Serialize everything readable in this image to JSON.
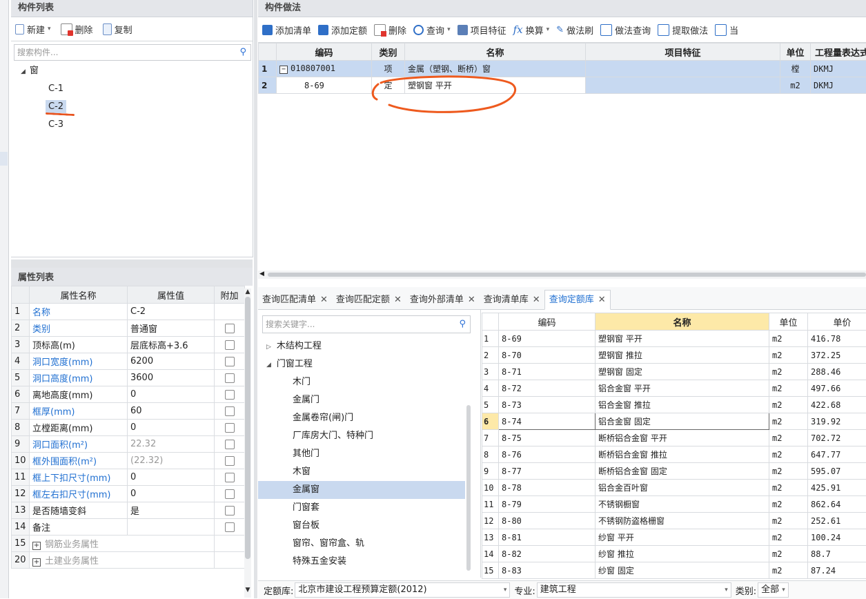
{
  "left_top": {
    "header": "构件列表",
    "toolbar": {
      "new": "新建",
      "delete": "删除",
      "copy": "复制"
    },
    "search_placeholder": "搜索构件...",
    "tree": {
      "root": "窗",
      "items": [
        "C-1",
        "C-2",
        "C-3"
      ]
    }
  },
  "props": {
    "header": "属性列表",
    "cols": [
      "属性名称",
      "属性值",
      "附加"
    ],
    "rows": [
      {
        "n": "1",
        "name": "名称",
        "value": "C-2",
        "blue": true,
        "cb": false
      },
      {
        "n": "2",
        "name": "类别",
        "value": "普通窗",
        "blue": true,
        "cb": true
      },
      {
        "n": "3",
        "name": "顶标高(m)",
        "value": "层底标高+3.6",
        "blue": false,
        "cb": true
      },
      {
        "n": "4",
        "name": "洞口宽度(mm)",
        "value": "6200",
        "blue": true,
        "cb": true
      },
      {
        "n": "5",
        "name": "洞口高度(mm)",
        "value": "3600",
        "blue": true,
        "cb": true
      },
      {
        "n": "6",
        "name": "离地高度(mm)",
        "value": "0",
        "blue": false,
        "cb": true
      },
      {
        "n": "7",
        "name": "框厚(mm)",
        "value": "60",
        "blue": true,
        "cb": true
      },
      {
        "n": "8",
        "name": "立樘距离(mm)",
        "value": "0",
        "blue": false,
        "cb": true
      },
      {
        "n": "9",
        "name": "洞口面积(m²)",
        "value": "22.32",
        "blue": true,
        "cb": true,
        "gray": true
      },
      {
        "n": "10",
        "name": "框外围面积(m²)",
        "value": "(22.32)",
        "blue": true,
        "cb": true,
        "gray": true
      },
      {
        "n": "11",
        "name": "框上下扣尺寸(mm)",
        "value": "0",
        "blue": true,
        "cb": true
      },
      {
        "n": "12",
        "name": "框左右扣尺寸(mm)",
        "value": "0",
        "blue": true,
        "cb": true
      },
      {
        "n": "13",
        "name": "是否随墙变斜",
        "value": "是",
        "blue": false,
        "cb": true
      },
      {
        "n": "14",
        "name": "备注",
        "value": "",
        "blue": false,
        "cb": true
      },
      {
        "n": "15",
        "name": "钢筋业务属性",
        "value": "",
        "blue": false,
        "cb": false,
        "group": true
      },
      {
        "n": "20",
        "name": "土建业务属性",
        "value": "",
        "blue": false,
        "cb": false,
        "group": true
      }
    ]
  },
  "method": {
    "header": "构件做法",
    "toolbar": [
      "添加清单",
      "添加定额",
      "删除",
      "查询",
      "项目特征",
      "换算",
      "做法刷",
      "做法查询",
      "提取做法",
      "当"
    ],
    "cols": [
      "编码",
      "类别",
      "名称",
      "项目特征",
      "单位",
      "工程量表达式"
    ],
    "rows": [
      {
        "n": "1",
        "code": "010807001",
        "type": "项",
        "name": "金属（塑钢、断桥）窗",
        "feature": "",
        "unit": "樘",
        "expr": "DKMJ"
      },
      {
        "n": "2",
        "code": "8-69",
        "type": "定",
        "name": "塑钢窗 平开",
        "feature": "",
        "unit": "m2",
        "expr": "DKMJ"
      }
    ]
  },
  "query": {
    "tabs": [
      "查询匹配清单",
      "查询匹配定额",
      "查询外部清单",
      "查询清单库",
      "查询定额库"
    ],
    "active_tab": 4,
    "search_placeholder": "搜索关键字...",
    "tree": [
      {
        "label": "木结构工程",
        "level": 0,
        "arrow": "▷"
      },
      {
        "label": "门窗工程",
        "level": 0,
        "arrow": "◢"
      },
      {
        "label": "木门",
        "level": 1
      },
      {
        "label": "金属门",
        "level": 1
      },
      {
        "label": "金属卷帘(闸)门",
        "level": 1
      },
      {
        "label": "厂库房大门、特种门",
        "level": 1
      },
      {
        "label": "其他门",
        "level": 1
      },
      {
        "label": "木窗",
        "level": 1
      },
      {
        "label": "金属窗",
        "level": 1,
        "selected": true
      },
      {
        "label": "门窗套",
        "level": 1
      },
      {
        "label": "窗台板",
        "level": 1
      },
      {
        "label": "窗帘、窗帘盒、轨",
        "level": 1
      },
      {
        "label": "特殊五金安装",
        "level": 1
      }
    ],
    "cols": [
      "编码",
      "名称",
      "单位",
      "单价"
    ],
    "rows": [
      {
        "n": "1",
        "code": "8-69",
        "name": "塑钢窗 平开",
        "unit": "m2",
        "price": "416.78"
      },
      {
        "n": "2",
        "code": "8-70",
        "name": "塑钢窗 推拉",
        "unit": "m2",
        "price": "372.25"
      },
      {
        "n": "3",
        "code": "8-71",
        "name": "塑钢窗 固定",
        "unit": "m2",
        "price": "288.46"
      },
      {
        "n": "4",
        "code": "8-72",
        "name": "铝合金窗 平开",
        "unit": "m2",
        "price": "497.66"
      },
      {
        "n": "5",
        "code": "8-73",
        "name": "铝合金窗 推拉",
        "unit": "m2",
        "price": "422.68"
      },
      {
        "n": "6",
        "code": "8-74",
        "name": "铝合金窗 固定",
        "unit": "m2",
        "price": "319.92"
      },
      {
        "n": "7",
        "code": "8-75",
        "name": "断桥铝合金窗 平开",
        "unit": "m2",
        "price": "702.72"
      },
      {
        "n": "8",
        "code": "8-76",
        "name": "断桥铝合金窗 推拉",
        "unit": "m2",
        "price": "647.77"
      },
      {
        "n": "9",
        "code": "8-77",
        "name": "断桥铝合金窗 固定",
        "unit": "m2",
        "price": "595.07"
      },
      {
        "n": "10",
        "code": "8-78",
        "name": "铝合金百叶窗",
        "unit": "m2",
        "price": "425.91"
      },
      {
        "n": "11",
        "code": "8-79",
        "name": "不锈钢橱窗",
        "unit": "m2",
        "price": "862.64"
      },
      {
        "n": "12",
        "code": "8-80",
        "name": "不锈钢防盗格栅窗",
        "unit": "m2",
        "price": "252.61"
      },
      {
        "n": "13",
        "code": "8-81",
        "name": "纱窗 平开",
        "unit": "m2",
        "price": "100.24"
      },
      {
        "n": "14",
        "code": "8-82",
        "name": "纱窗 推拉",
        "unit": "m2",
        "price": "88.7"
      },
      {
        "n": "15",
        "code": "8-83",
        "name": "纱窗 固定",
        "unit": "m2",
        "price": "87.24"
      }
    ],
    "footer": {
      "lib_label": "定额库:",
      "lib_value": "北京市建设工程预算定额(2012)",
      "spec_label": "专业:",
      "spec_value": "建筑工程",
      "cat_label": "类别:",
      "cat_value": "全部"
    }
  }
}
